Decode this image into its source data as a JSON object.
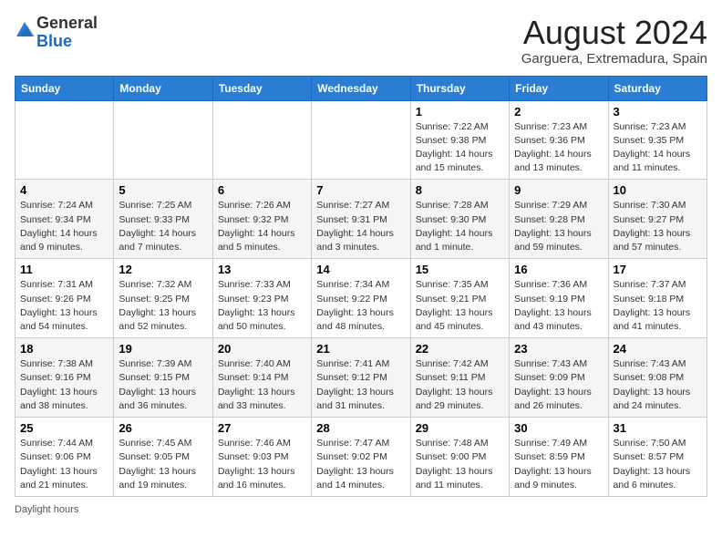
{
  "header": {
    "logo_general": "General",
    "logo_blue": "Blue",
    "title": "August 2024",
    "subtitle": "Garguera, Extremadura, Spain"
  },
  "calendar": {
    "weekdays": [
      "Sunday",
      "Monday",
      "Tuesday",
      "Wednesday",
      "Thursday",
      "Friday",
      "Saturday"
    ],
    "weeks": [
      [
        {
          "day": "",
          "info": ""
        },
        {
          "day": "",
          "info": ""
        },
        {
          "day": "",
          "info": ""
        },
        {
          "day": "",
          "info": ""
        },
        {
          "day": "1",
          "info": "Sunrise: 7:22 AM\nSunset: 9:38 PM\nDaylight: 14 hours and 15 minutes."
        },
        {
          "day": "2",
          "info": "Sunrise: 7:23 AM\nSunset: 9:36 PM\nDaylight: 14 hours and 13 minutes."
        },
        {
          "day": "3",
          "info": "Sunrise: 7:23 AM\nSunset: 9:35 PM\nDaylight: 14 hours and 11 minutes."
        }
      ],
      [
        {
          "day": "4",
          "info": "Sunrise: 7:24 AM\nSunset: 9:34 PM\nDaylight: 14 hours and 9 minutes."
        },
        {
          "day": "5",
          "info": "Sunrise: 7:25 AM\nSunset: 9:33 PM\nDaylight: 14 hours and 7 minutes."
        },
        {
          "day": "6",
          "info": "Sunrise: 7:26 AM\nSunset: 9:32 PM\nDaylight: 14 hours and 5 minutes."
        },
        {
          "day": "7",
          "info": "Sunrise: 7:27 AM\nSunset: 9:31 PM\nDaylight: 14 hours and 3 minutes."
        },
        {
          "day": "8",
          "info": "Sunrise: 7:28 AM\nSunset: 9:30 PM\nDaylight: 14 hours and 1 minute."
        },
        {
          "day": "9",
          "info": "Sunrise: 7:29 AM\nSunset: 9:28 PM\nDaylight: 13 hours and 59 minutes."
        },
        {
          "day": "10",
          "info": "Sunrise: 7:30 AM\nSunset: 9:27 PM\nDaylight: 13 hours and 57 minutes."
        }
      ],
      [
        {
          "day": "11",
          "info": "Sunrise: 7:31 AM\nSunset: 9:26 PM\nDaylight: 13 hours and 54 minutes."
        },
        {
          "day": "12",
          "info": "Sunrise: 7:32 AM\nSunset: 9:25 PM\nDaylight: 13 hours and 52 minutes."
        },
        {
          "day": "13",
          "info": "Sunrise: 7:33 AM\nSunset: 9:23 PM\nDaylight: 13 hours and 50 minutes."
        },
        {
          "day": "14",
          "info": "Sunrise: 7:34 AM\nSunset: 9:22 PM\nDaylight: 13 hours and 48 minutes."
        },
        {
          "day": "15",
          "info": "Sunrise: 7:35 AM\nSunset: 9:21 PM\nDaylight: 13 hours and 45 minutes."
        },
        {
          "day": "16",
          "info": "Sunrise: 7:36 AM\nSunset: 9:19 PM\nDaylight: 13 hours and 43 minutes."
        },
        {
          "day": "17",
          "info": "Sunrise: 7:37 AM\nSunset: 9:18 PM\nDaylight: 13 hours and 41 minutes."
        }
      ],
      [
        {
          "day": "18",
          "info": "Sunrise: 7:38 AM\nSunset: 9:16 PM\nDaylight: 13 hours and 38 minutes."
        },
        {
          "day": "19",
          "info": "Sunrise: 7:39 AM\nSunset: 9:15 PM\nDaylight: 13 hours and 36 minutes."
        },
        {
          "day": "20",
          "info": "Sunrise: 7:40 AM\nSunset: 9:14 PM\nDaylight: 13 hours and 33 minutes."
        },
        {
          "day": "21",
          "info": "Sunrise: 7:41 AM\nSunset: 9:12 PM\nDaylight: 13 hours and 31 minutes."
        },
        {
          "day": "22",
          "info": "Sunrise: 7:42 AM\nSunset: 9:11 PM\nDaylight: 13 hours and 29 minutes."
        },
        {
          "day": "23",
          "info": "Sunrise: 7:43 AM\nSunset: 9:09 PM\nDaylight: 13 hours and 26 minutes."
        },
        {
          "day": "24",
          "info": "Sunrise: 7:43 AM\nSunset: 9:08 PM\nDaylight: 13 hours and 24 minutes."
        }
      ],
      [
        {
          "day": "25",
          "info": "Sunrise: 7:44 AM\nSunset: 9:06 PM\nDaylight: 13 hours and 21 minutes."
        },
        {
          "day": "26",
          "info": "Sunrise: 7:45 AM\nSunset: 9:05 PM\nDaylight: 13 hours and 19 minutes."
        },
        {
          "day": "27",
          "info": "Sunrise: 7:46 AM\nSunset: 9:03 PM\nDaylight: 13 hours and 16 minutes."
        },
        {
          "day": "28",
          "info": "Sunrise: 7:47 AM\nSunset: 9:02 PM\nDaylight: 13 hours and 14 minutes."
        },
        {
          "day": "29",
          "info": "Sunrise: 7:48 AM\nSunset: 9:00 PM\nDaylight: 13 hours and 11 minutes."
        },
        {
          "day": "30",
          "info": "Sunrise: 7:49 AM\nSunset: 8:59 PM\nDaylight: 13 hours and 9 minutes."
        },
        {
          "day": "31",
          "info": "Sunrise: 7:50 AM\nSunset: 8:57 PM\nDaylight: 13 hours and 6 minutes."
        }
      ]
    ]
  },
  "footer": {
    "daylight_label": "Daylight hours"
  }
}
